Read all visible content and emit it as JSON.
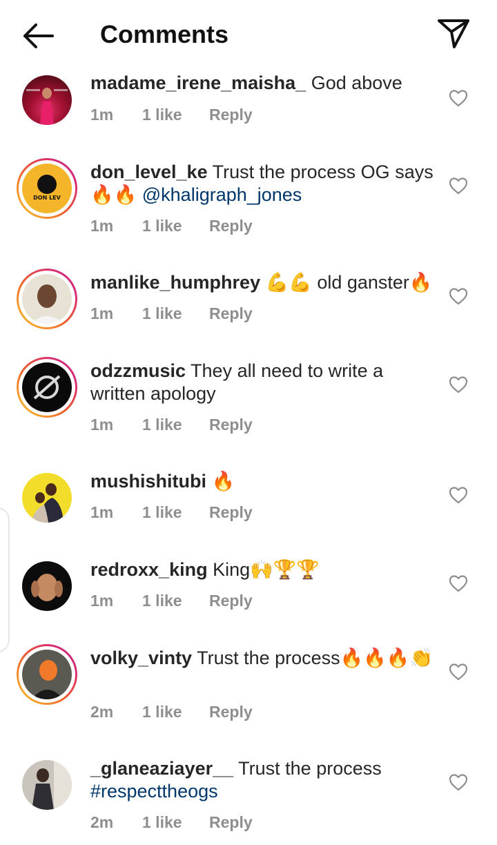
{
  "header": {
    "title": "Comments"
  },
  "comments": [
    {
      "username": "madame_irene_maisha_",
      "text": " God above",
      "mention": "",
      "time": "1m",
      "likes": "1 like",
      "reply": "Reply"
    },
    {
      "username": "don_level_ke",
      "text": " Trust the process OG says 🔥🔥 ",
      "mention": "@khaligraph_jones",
      "time": "1m",
      "likes": "1 like",
      "reply": "Reply"
    },
    {
      "username": "manlike_humphrey",
      "text": " 💪💪 old ganster🔥",
      "mention": "",
      "time": "1m",
      "likes": "1 like",
      "reply": "Reply"
    },
    {
      "username": "odzzmusic",
      "text": " They all need to write a written apology",
      "mention": "",
      "time": "1m",
      "likes": "1 like",
      "reply": "Reply"
    },
    {
      "username": "mushishitubi",
      "text": " 🔥",
      "mention": "",
      "time": "1m",
      "likes": "1 like",
      "reply": "Reply"
    },
    {
      "username": "redroxx_king",
      "text": " King🙌🏆🏆",
      "mention": "",
      "time": "1m",
      "likes": "1 like",
      "reply": "Reply"
    },
    {
      "username": "volky_vinty",
      "text": " Trust the process🔥🔥🔥👏",
      "mention": "",
      "time": "2m",
      "likes": "1 like",
      "reply": "Reply"
    },
    {
      "username": "_glaneaziayer__",
      "text": " Trust the process ",
      "mention": "#respecttheogs",
      "time": "2m",
      "likes": "1 like",
      "reply": "Reply"
    }
  ]
}
